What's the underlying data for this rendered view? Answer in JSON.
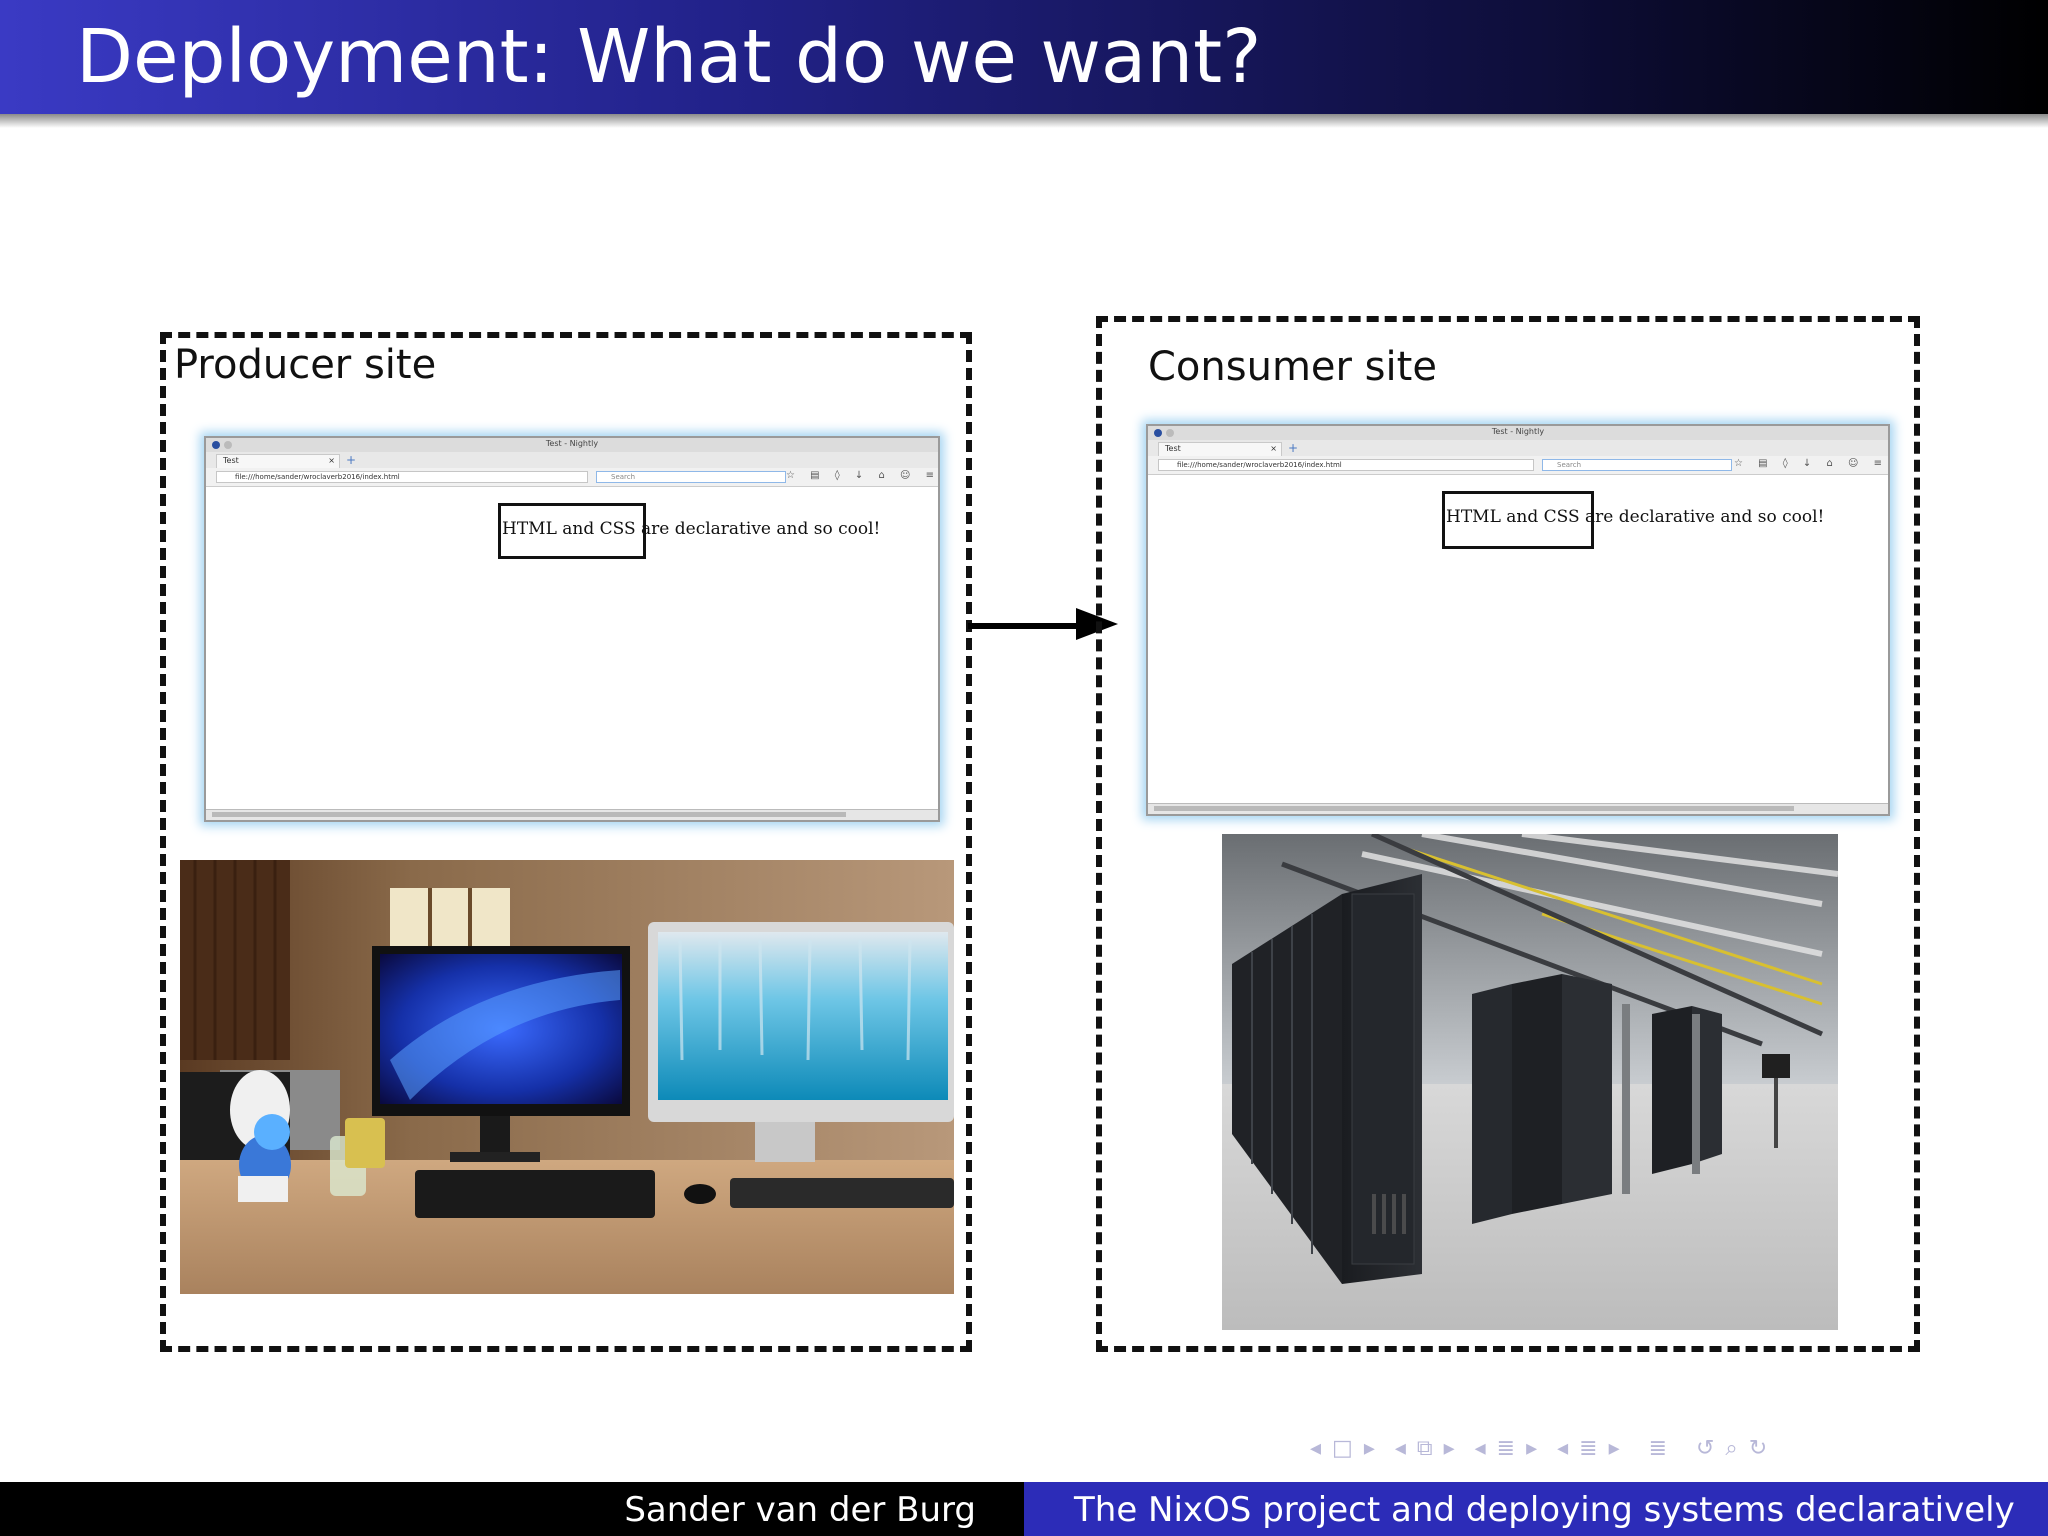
{
  "slide": {
    "title": "Deployment: What do we want?"
  },
  "producer": {
    "label": "Producer site",
    "browser": {
      "window_title": "Test - Nightly",
      "tab_label": "Test",
      "url": "file:///home/sander/wroclaverb2016/index.html",
      "search_placeholder": "Search",
      "page_text": "HTML and CSS are declarative and so cool!"
    },
    "photo": "desk-workstation-photo"
  },
  "consumer": {
    "label": "Consumer site",
    "browser": {
      "window_title": "Test - Nightly",
      "tab_label": "Test",
      "url": "file:///home/sander/wroclaverb2016/index.html",
      "search_placeholder": "Search",
      "page_text": "HTML and CSS are declarative and so cool!"
    },
    "photo": "datacenter-server-racks-photo"
  },
  "footer": {
    "author": "Sander van der Burg",
    "talk_title": "The NixOS project and deploying systems declaratively"
  },
  "colors": {
    "title_bar_start": "#3a3ac4",
    "title_bar_end": "#000000",
    "footer_right": "#2c2cb8",
    "browser_glow": "#a7d5f2"
  }
}
